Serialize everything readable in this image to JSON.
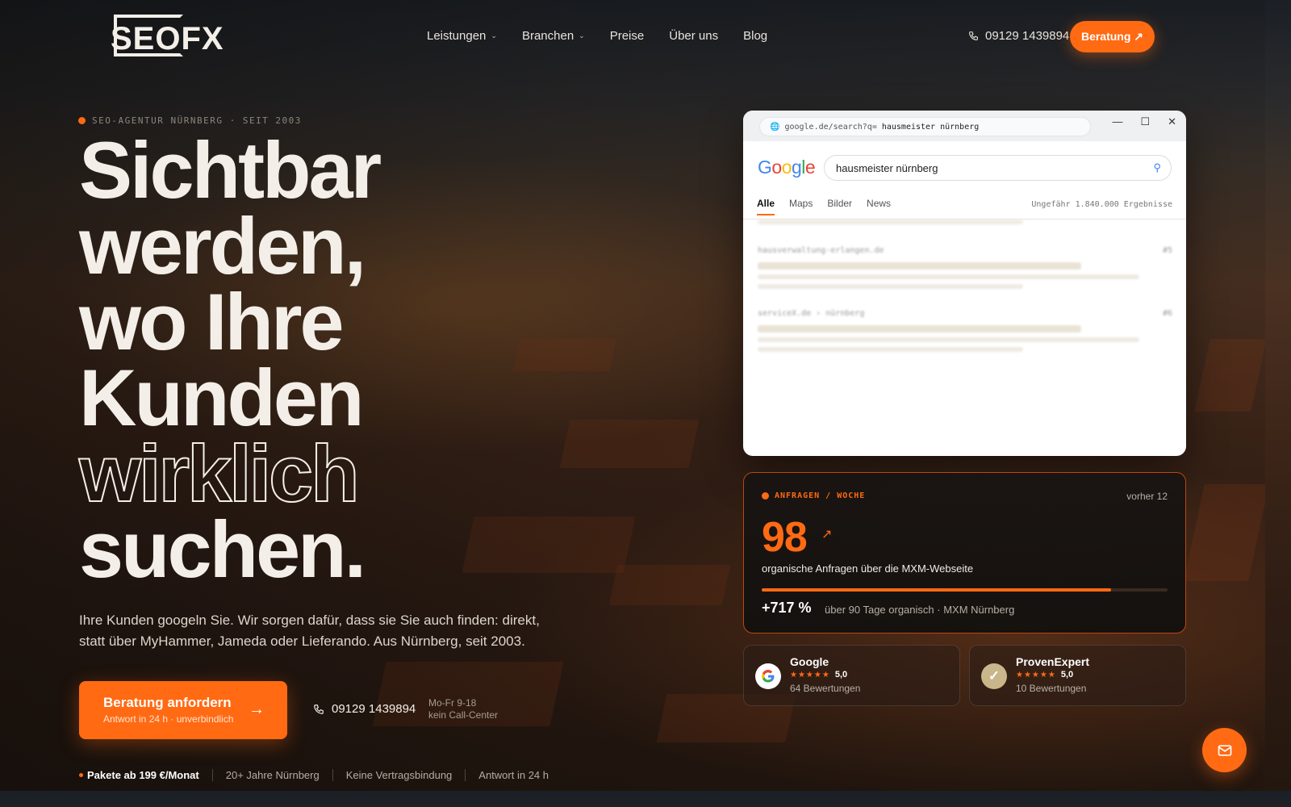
{
  "nav": {
    "logo": "SEOFX",
    "menu": [
      "Leistungen",
      "Branchen",
      "Preise",
      "Über uns",
      "Blog"
    ],
    "phone": "09129 1439894",
    "cta": "Beratung ↗"
  },
  "hero": {
    "eyebrow": "SEO-AGENTUR NÜRNBERG · SEIT 2003",
    "headline": [
      "Sichtbar",
      "werden,",
      "wo Ihre",
      "Kunden",
      "wirklich",
      "suchen."
    ],
    "lead": "Ihre Kunden googeln Sie. Wir sorgen dafür, dass sie Sie auch finden: direkt, statt über MyHammer, Jameda oder Lieferando. Aus Nürnberg, seit 2003.",
    "cta_title": "Beratung anfordern",
    "cta_sub": "Antwort in 24 h · unverbindlich",
    "phone": "09129 1439894",
    "hours": [
      "Mo-Fr 9-18",
      "kein Call-Center"
    ],
    "trust": [
      "Pakete ab 199 €/Monat",
      "20+ Jahre Nürnberg",
      "Keine Vertragsbindung",
      "Antwort in 24 h"
    ]
  },
  "browser": {
    "url_prefix": "google.de/search?q=",
    "url_query": "hausmeister nürnberg",
    "search_value": "hausmeister nürnberg",
    "tabs": [
      "Alle",
      "Maps",
      "Bilder",
      "News"
    ],
    "active_tab": "Alle",
    "result_count": "Ungefähr 1.840.000 Ergebnisse",
    "results": [
      {
        "domain": "hausverwaltung-erlangen.de",
        "pos": "#5"
      },
      {
        "domain": "serviceX.de › nürnberg",
        "pos": "#6"
      }
    ]
  },
  "metric": {
    "label": "ANFRAGEN / WOCHE",
    "previous": "vorher 12",
    "value": "98",
    "description": "organische Anfragen über die MXM-Webseite",
    "progress": 0.86,
    "delta": "+717 %",
    "note": "über 90 Tage organisch · MXM Nürnberg"
  },
  "reviews": [
    {
      "name": "Google",
      "stars": "★★★★★",
      "rating": "5,0",
      "count": "64 Bewertungen"
    },
    {
      "name": "ProvenExpert",
      "stars": "★★★★★",
      "rating": "5,0",
      "count": "10 Bewertungen"
    }
  ],
  "colors": {
    "accent": "#ff6a13",
    "text": "#f3efe8"
  }
}
